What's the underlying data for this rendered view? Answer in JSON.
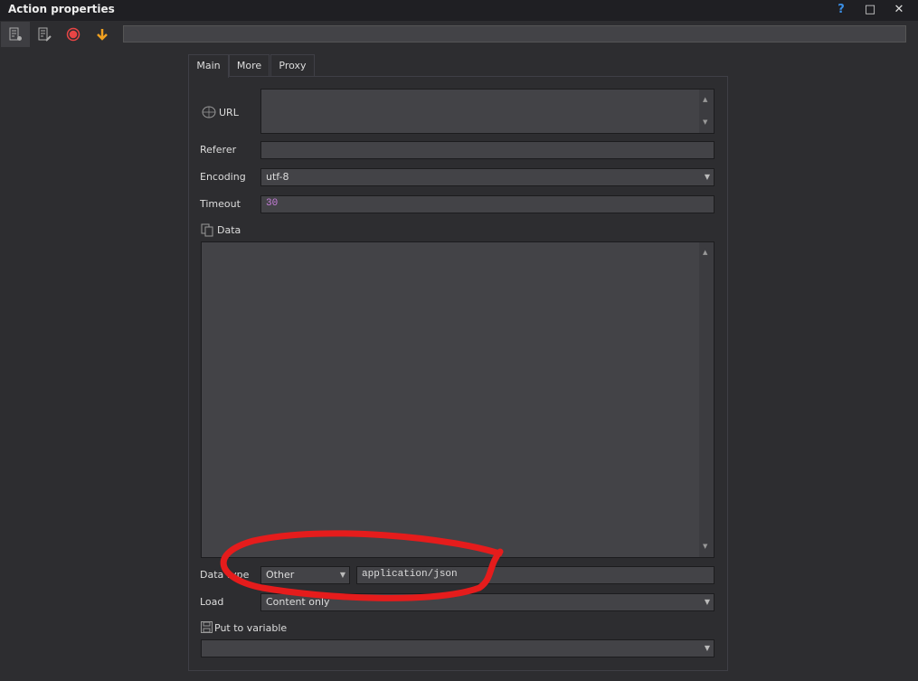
{
  "window": {
    "title": "Action properties",
    "help": "?",
    "maximize": "□",
    "close": "✕"
  },
  "toolbar": {
    "icons": [
      "properties-icon",
      "edit-icon",
      "record-icon",
      "download-arrow-icon"
    ],
    "input_value": ""
  },
  "tabs": [
    {
      "label": "Main",
      "active": true
    },
    {
      "label": "More"
    },
    {
      "label": "Proxy"
    }
  ],
  "form": {
    "url": {
      "label": "URL",
      "value": ""
    },
    "referer": {
      "label": "Referer",
      "value": ""
    },
    "encoding": {
      "label": "Encoding",
      "value": "utf-8"
    },
    "timeout": {
      "label": "Timeout",
      "value": "30"
    },
    "data": {
      "label": "Data",
      "value": ""
    },
    "data_type": {
      "label": "Data type",
      "value": "Other",
      "content_type": "application/json"
    },
    "load": {
      "label": "Load",
      "value": "Content only"
    },
    "put_to_variable": {
      "label": "Put to variable",
      "value": ""
    }
  },
  "colors": {
    "annotation": "#e51c1c",
    "timeout_value": "#c77ddb",
    "record": "#e84545",
    "arrow": "#f0a020"
  }
}
